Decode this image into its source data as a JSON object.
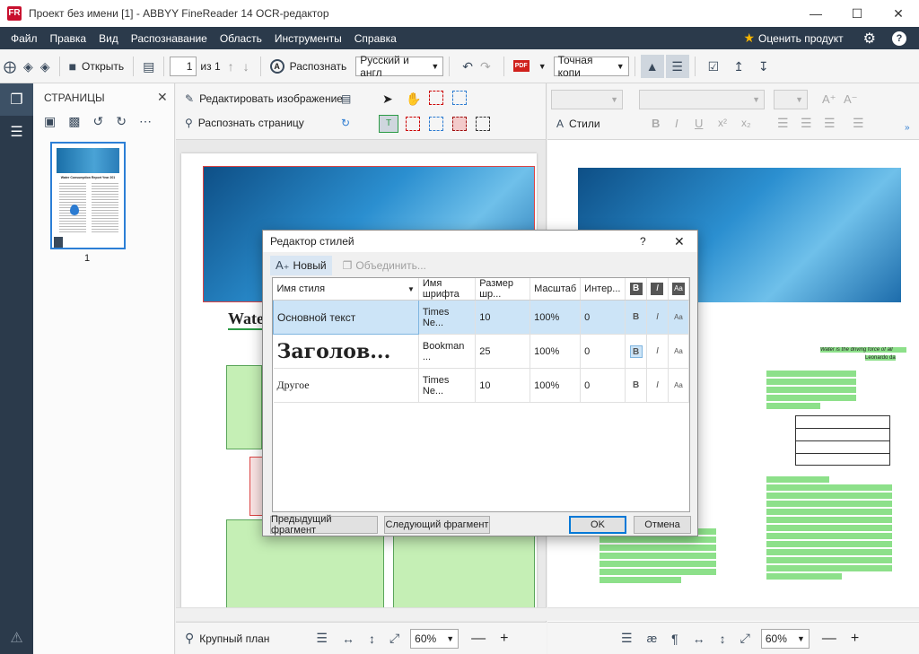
{
  "window": {
    "title": "Проект без имени [1] - ABBYY FineReader 14 OCR-редактор",
    "app_icon": "FR"
  },
  "menu": {
    "items": [
      "Файл",
      "Правка",
      "Вид",
      "Распознавание",
      "Область",
      "Инструменты",
      "Справка"
    ],
    "rate": "Оценить продукт"
  },
  "toolbar": {
    "open": "Открыть",
    "page_num": "1",
    "page_of": "из 1",
    "recognize": "Распознать",
    "language": "Русский и англ",
    "save_format": "Точная копи",
    "pdf": "PDF"
  },
  "pages_panel": {
    "title": "СТРАНИЦЫ",
    "thumb_label": "1",
    "thumb_title": "Water Consumption Report Year 201"
  },
  "image_panel": {
    "edit_image": "Редактировать изображение",
    "recognize_page": "Распознать страницу",
    "zoom_label": "Крупный план",
    "zoom_value": "60%"
  },
  "text_panel": {
    "styles": "Стили",
    "zoom_value": "60%"
  },
  "document": {
    "heading": "Wate",
    "quote": "Water is the driving force of all",
    "quote_author": "Leonardo da"
  },
  "dialog": {
    "title": "Редактор стилей",
    "help": "?",
    "new_btn": "Новый",
    "merge_btn": "Объединить...",
    "columns": [
      "Имя стиля",
      "Имя шрифта",
      "Размер шр...",
      "Масштаб",
      "Интер..."
    ],
    "rows": [
      {
        "name": "Основной текст",
        "font": "Times Ne...",
        "size": "10",
        "scale": "100%",
        "spacing": "0",
        "selected": true
      },
      {
        "name": "Заголов...",
        "font": "Bookman ...",
        "size": "25",
        "scale": "100%",
        "spacing": "0",
        "selected": false
      },
      {
        "name": "Другое",
        "font": "Times Ne...",
        "size": "10",
        "scale": "100%",
        "spacing": "0",
        "selected": false
      }
    ],
    "prev_btn": "Предыдущий фрагмент",
    "next_btn": "Следующий фрагмент",
    "ok_btn": "OK",
    "cancel_btn": "Отмена"
  },
  "colors": {
    "menubar": "#2b3a4b",
    "accent": "#2c7fd6",
    "selection": "#cce4f7",
    "recognized": "#8de08a"
  }
}
